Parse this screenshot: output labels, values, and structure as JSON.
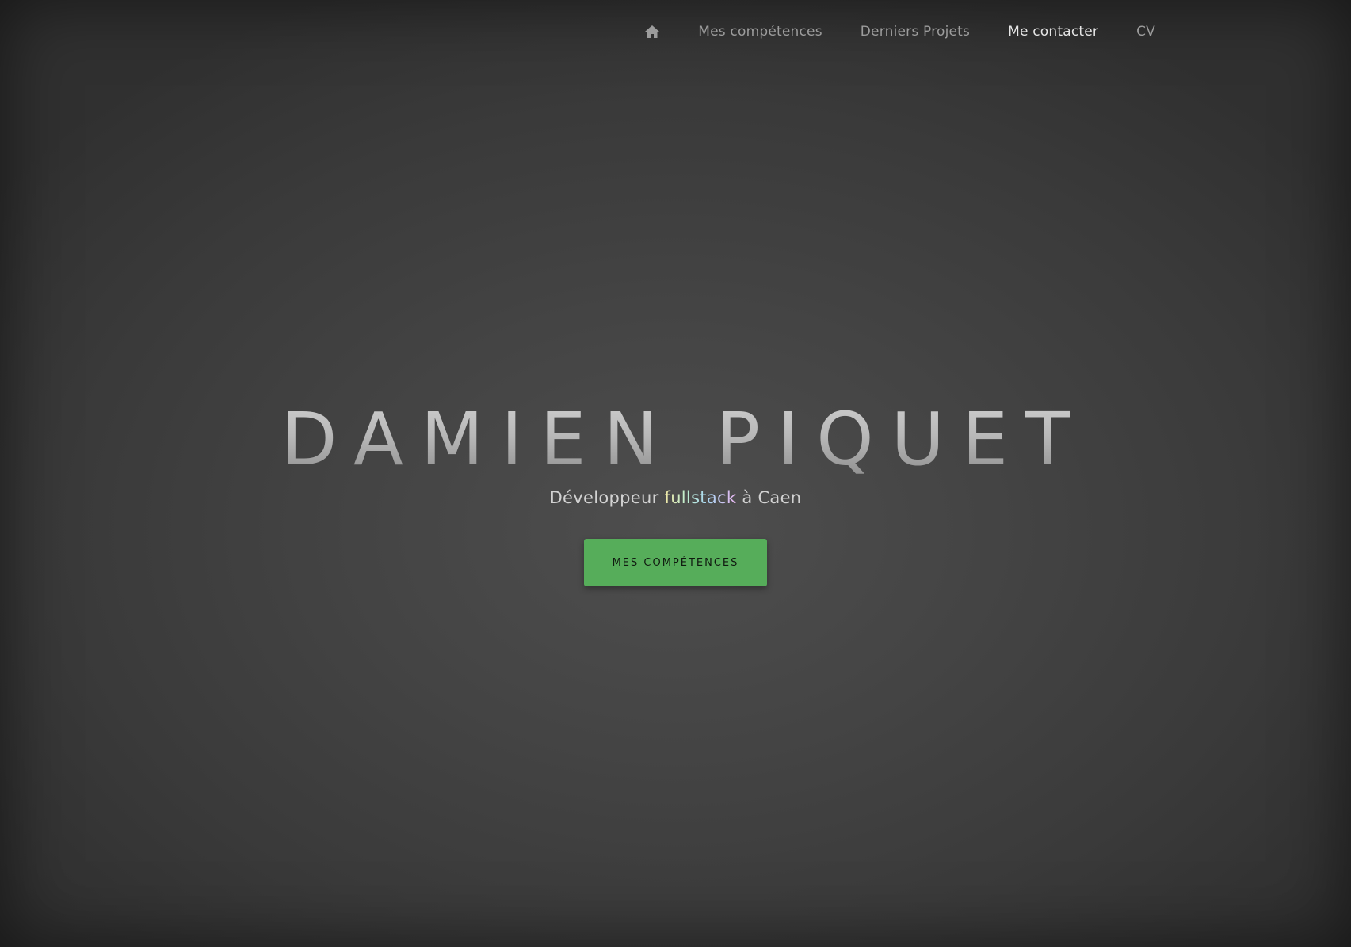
{
  "nav": {
    "home_icon": "home-icon",
    "items": [
      {
        "label": "Mes compétences"
      },
      {
        "label": "Derniers Projets"
      },
      {
        "label": "Me contacter"
      },
      {
        "label": "CV"
      }
    ]
  },
  "hero": {
    "title": "DAMIEN PIQUET",
    "subtitle_prefix": "Développeur",
    "subtitle_highlight": "fullstack",
    "subtitle_suffix": "à Caen",
    "button_label": "MES COMPÉTENCES"
  },
  "colors": {
    "button": "#56ad5a",
    "background": "#444444",
    "nav_text": "#9c9c9c",
    "nav_active": "#e6e6e6"
  }
}
